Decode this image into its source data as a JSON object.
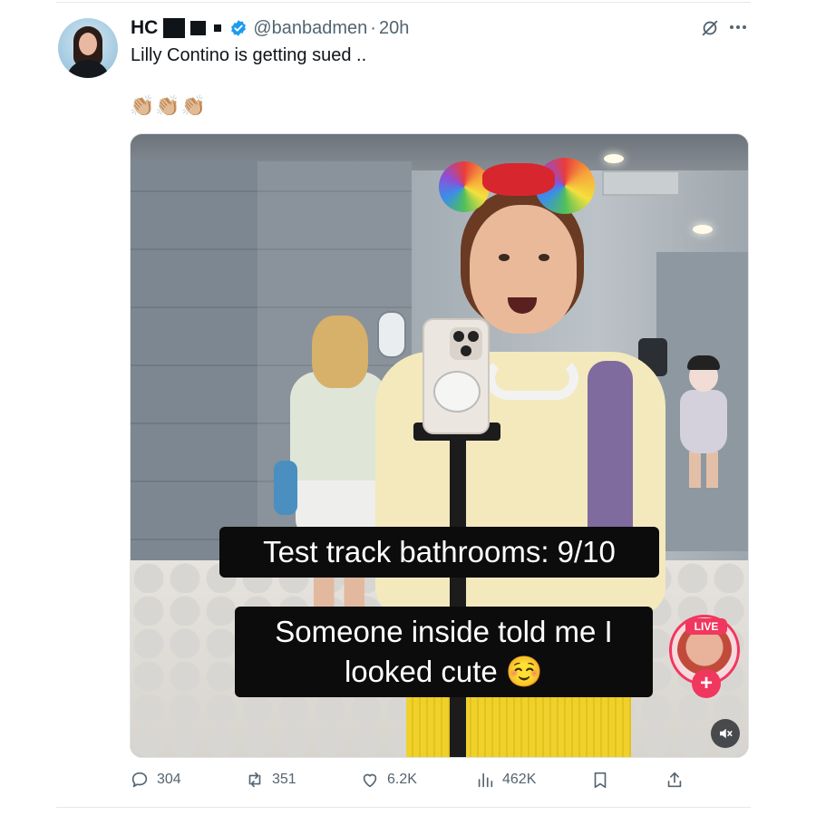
{
  "tweet": {
    "author_name": "HC",
    "handle": "@banbadmen",
    "separator": "·",
    "time": "20h",
    "text": "Lilly Contino is getting sued ..",
    "emoji_line": "👏🏼👏🏼👏🏼"
  },
  "media": {
    "caption_1": "Test track bathrooms: 9/10",
    "caption_2_line1": "Someone inside told me I",
    "caption_2_line2": "looked cute ☺️",
    "live_label": "LIVE",
    "live_plus": "+",
    "child_emoji": "👧🏻"
  },
  "actions": {
    "replies": "304",
    "reposts": "351",
    "likes": "6.2K",
    "views": "462K"
  },
  "colors": {
    "text": "#0f1419",
    "muted": "#536471",
    "verified": "#1d9bf0",
    "live": "#f0375e",
    "caption_bg": "#0c0c0c"
  },
  "icons": [
    "verified-badge-icon",
    "grok-icon",
    "more-icon",
    "reply-icon",
    "repost-icon",
    "like-icon",
    "views-icon",
    "bookmark-icon",
    "share-icon",
    "mute-icon"
  ]
}
